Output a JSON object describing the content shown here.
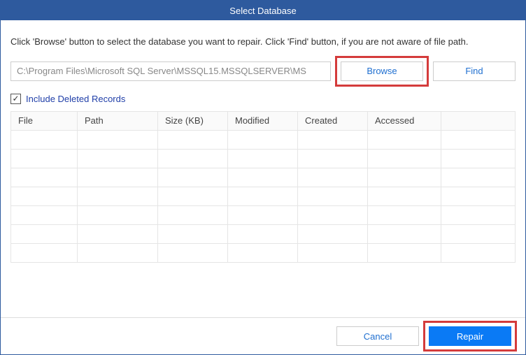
{
  "title": "Select Database",
  "instruction": "Click 'Browse' button to select the database you want to repair. Click 'Find' button, if you are not aware of file path.",
  "path_value": "C:\\Program Files\\Microsoft SQL Server\\MSSQL15.MSSQLSERVER\\MS",
  "buttons": {
    "browse": "Browse",
    "find": "Find",
    "cancel": "Cancel",
    "repair": "Repair"
  },
  "checkbox": {
    "checked": true,
    "label": "Include Deleted Records"
  },
  "grid_headers": {
    "file": "File",
    "path": "Path",
    "size": "Size (KB)",
    "modified": "Modified",
    "created": "Created",
    "accessed": "Accessed"
  }
}
